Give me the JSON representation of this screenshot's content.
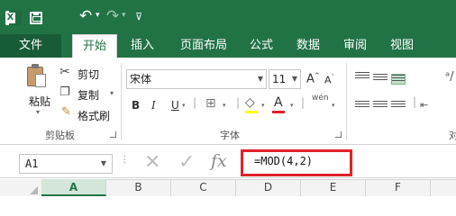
{
  "titlebar": {
    "app_icon_letter": "X",
    "undo_glyph": "↶",
    "redo_glyph": "↷",
    "customize_glyph": "⊽"
  },
  "tabs": [
    {
      "label": "文件",
      "active": false
    },
    {
      "label": "开始",
      "active": true
    },
    {
      "label": "插入",
      "active": false
    },
    {
      "label": "页面布局",
      "active": false
    },
    {
      "label": "公式",
      "active": false
    },
    {
      "label": "数据",
      "active": false
    },
    {
      "label": "审阅",
      "active": false
    },
    {
      "label": "视图",
      "active": false
    }
  ],
  "clipboard": {
    "paste_label": "粘贴",
    "cut_label": "剪切",
    "copy_label": "复制",
    "format_painter_label": "格式刷",
    "group_label": "剪贴板"
  },
  "font": {
    "font_name": "宋体",
    "font_size": "11",
    "bold": "B",
    "italic": "I",
    "underline": "U",
    "phonetic": "wén",
    "group_label": "字体"
  },
  "alignment": {
    "group_label_partial": "对"
  },
  "formula_bar": {
    "name_box": "A1",
    "cancel_glyph": "✕",
    "enter_glyph": "✓",
    "fx_label": "fx",
    "formula": "=MOD(4,2)",
    "highlight_color": "#e0222a"
  },
  "columns": [
    "A",
    "B",
    "C",
    "D",
    "E",
    "F"
  ],
  "colors": {
    "brand": "#217346",
    "ribbon_bg": "#ffffff"
  }
}
